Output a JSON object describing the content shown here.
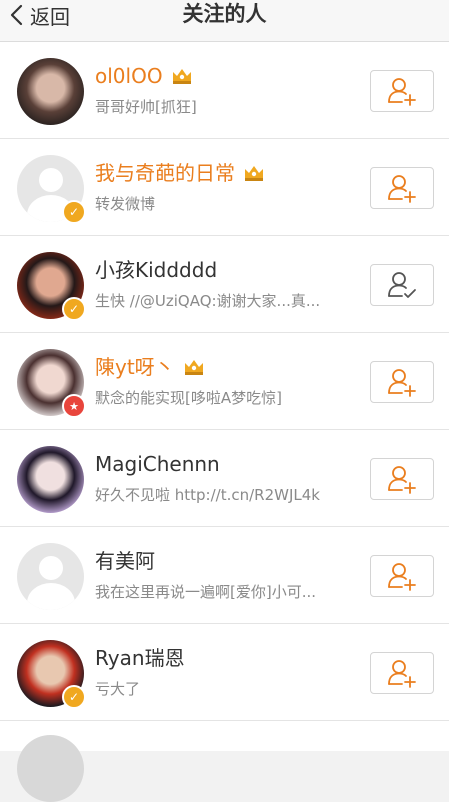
{
  "nav": {
    "back_label": "返回",
    "title": "关注的人"
  },
  "colors": {
    "accent": "#ea7e1e",
    "vip_gold": "#f0a820",
    "star_red": "#e8453c"
  },
  "users": [
    {
      "name": "ol0lOO",
      "desc": "哥哥好帅[抓狂]",
      "name_color": "orange",
      "vip": true,
      "badge": "none",
      "avatar": "photo",
      "avatar_colors": [
        "#2a2220",
        "#d8b8a8",
        "#5a4038"
      ],
      "following_state": "add"
    },
    {
      "name": "我与奇葩的日常",
      "desc": "转发微博",
      "name_color": "orange",
      "vip": true,
      "badge": "gold-v",
      "avatar": "default",
      "following_state": "add"
    },
    {
      "name": "小孩Kiddddd",
      "desc": "生快 //@UziQAQ:谢谢大家...真...",
      "name_color": "black",
      "vip": false,
      "badge": "gold-v",
      "avatar": "photo",
      "avatar_colors": [
        "#8a2a18",
        "#e0a890",
        "#241818"
      ],
      "following_state": "following"
    },
    {
      "name": "陳yt呀丶",
      "desc": "默念的能实现[哆啦A梦吃惊]",
      "name_color": "orange",
      "vip": true,
      "badge": "red-star",
      "avatar": "photo",
      "avatar_colors": [
        "#d8d0d0",
        "#f0d8d0",
        "#4a3030"
      ],
      "following_state": "add"
    },
    {
      "name": "MagiChennn",
      "desc": "好久不见啦 http://t.cn/R2WJL4k",
      "name_color": "black",
      "vip": false,
      "badge": "none",
      "avatar": "photo",
      "avatar_colors": [
        "#b8a0d0",
        "#f0e0e0",
        "#20182a"
      ],
      "following_state": "add"
    },
    {
      "name": "有美阿",
      "desc": "我在这里再说一遍啊[爱你]小可...",
      "name_color": "black",
      "vip": false,
      "badge": "none",
      "avatar": "default",
      "following_state": "add"
    },
    {
      "name": "Ryan瑞恩",
      "desc": "亏大了",
      "name_color": "black",
      "vip": false,
      "badge": "gold-v",
      "avatar": "photo",
      "avatar_colors": [
        "#101820",
        "#e8c8b0",
        "#c03020"
      ],
      "following_state": "add"
    }
  ]
}
